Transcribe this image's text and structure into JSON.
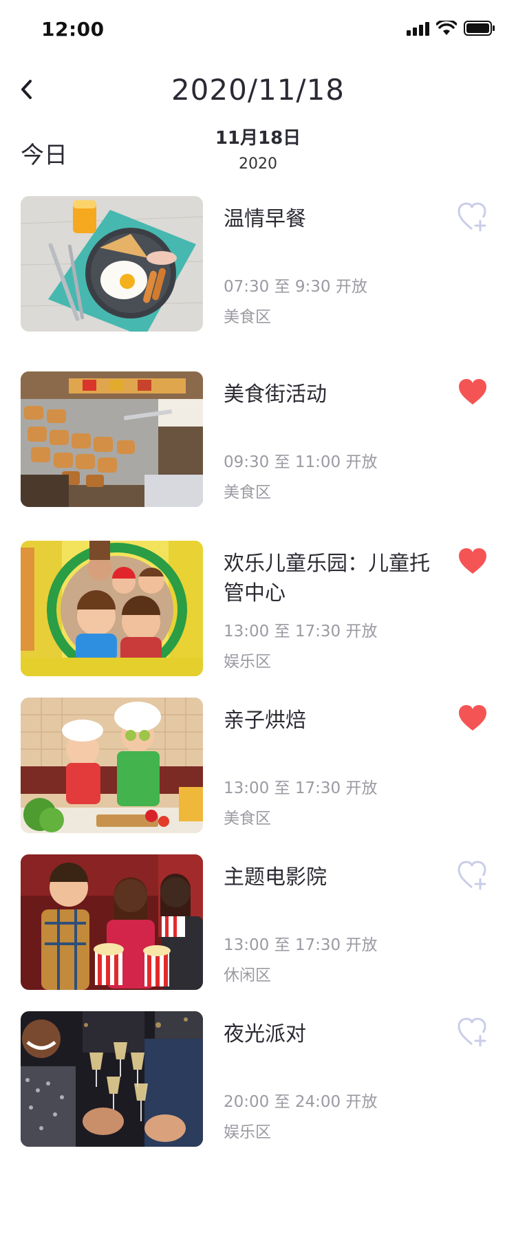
{
  "status_bar": {
    "time": "12:00"
  },
  "header": {
    "title": "2020/11/18",
    "back_icon": "chevron-left-icon"
  },
  "date_bar": {
    "today_label": "今日",
    "date": "11月18日",
    "year": "2020"
  },
  "colors": {
    "heart_active": "#f55454",
    "heart_inactive": "#c9cde8",
    "secondary_text": "#9a9aa2"
  },
  "events": [
    {
      "name": "温情早餐",
      "hours": "07:30 至 9:30 开放",
      "area": "美食区",
      "favorited": false
    },
    {
      "name": "美食街活动",
      "hours": "09:30 至 11:00 开放",
      "area": "美食区",
      "favorited": true
    },
    {
      "name": "欢乐儿童乐园：儿童托管中心",
      "hours": "13:00 至 17:30 开放",
      "area": "娱乐区",
      "favorited": true
    },
    {
      "name": "亲子烘焙",
      "hours": "13:00 至 17:30 开放",
      "area": "美食区",
      "favorited": true
    },
    {
      "name": "主题电影院",
      "hours": "13:00 至 17:30 开放",
      "area": "休闲区",
      "favorited": false
    },
    {
      "name": "夜光派对",
      "hours": "20:00 至 24:00 开放",
      "area": "娱乐区",
      "favorited": false
    }
  ]
}
